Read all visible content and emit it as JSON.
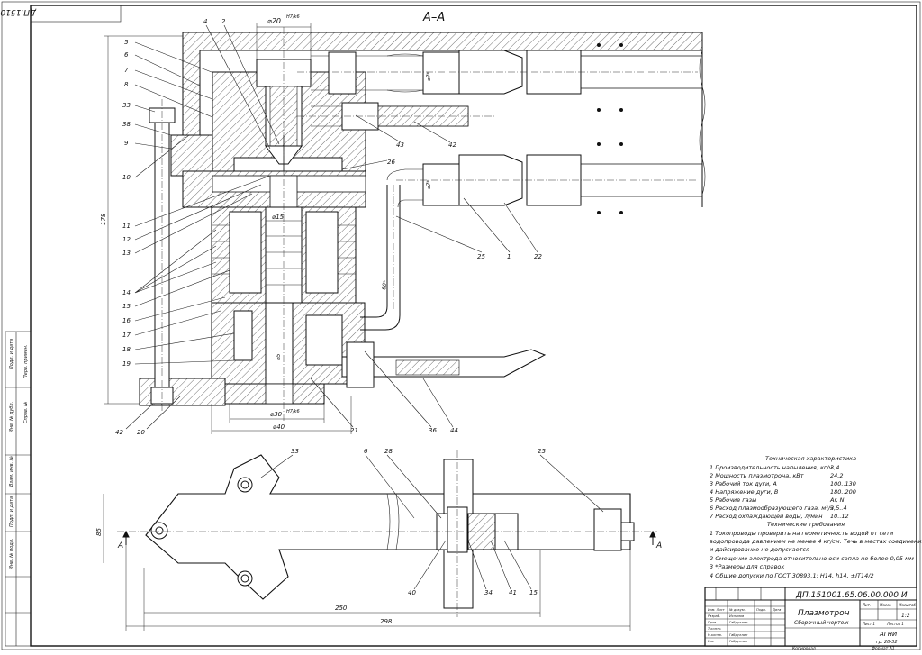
{
  "drawing": {
    "section_label": "А–А",
    "rotated_stamp": "ДП.151001.65.06.00.000 И",
    "side_cells": [
      "Подп. и дата",
      "Инв. № дубл.",
      "Взам. инв. №",
      "Подп. и дата",
      "Инв. № подл.",
      "Справ. №",
      "Перв. примен."
    ],
    "dims_top": {
      "d_top": "⌀20",
      "d_top_fit": "H7/k6",
      "d15": "⌀15",
      "d30": "⌀30",
      "d30_fit": "H7/k6",
      "d40": "⌀40",
      "d5": "⌀5",
      "d7a": "⌀7*",
      "d7b": "⌀7*",
      "r60": "60*",
      "h178": "178"
    },
    "dims_bottom": {
      "w250": "250",
      "w298": "298",
      "h85": "85",
      "section_mark": "A"
    },
    "leaders_left": [
      "5",
      "6",
      "7",
      "8",
      "33",
      "38",
      "9",
      "10",
      "11",
      "12",
      "13",
      "14",
      "15",
      "16",
      "17",
      "18",
      "19",
      "42",
      "20"
    ],
    "leaders_top": [
      "4",
      "2"
    ],
    "leaders_right": [
      "43",
      "42",
      "26",
      "25",
      "1",
      "22",
      "21",
      "36",
      "44"
    ],
    "leaders_plan": [
      "33",
      "6",
      "28",
      "25",
      "40",
      "34",
      "41",
      "15"
    ]
  },
  "specs": {
    "title": "Техническая характеристика",
    "rows": [
      {
        "label": "1 Производительность напыления, кг/ч",
        "value": "3,4"
      },
      {
        "label": "2 Мощность плазмотрона, кВт",
        "value": "24,2"
      },
      {
        "label": "3 Рабочий ток дуги, А",
        "value": "100..130"
      },
      {
        "label": "4 Напряжение дуги, В",
        "value": "180..200"
      },
      {
        "label": "5 Рабочие газы",
        "value": "Ar, N"
      },
      {
        "label": "6 Расход плазмообразующего газа, м³/ч",
        "value": "3,5..4"
      },
      {
        "label": "7 Расход охлаждающей воды, л/мин",
        "value": "10..12"
      }
    ],
    "req_title": "Технические требования",
    "requirements": [
      "1 Токопроводы проверить на герметичность водой от сети",
      "водопровода давлением не менее 4 кг/см. Течь в местах соединения",
      "и дайсирование не допускается",
      "2 Смещение электрода относительно оси сопла не более 0,05 мм",
      "3 *Размеры для справок",
      "4 Общие допуски по ГОСТ 30893.1: H14, h14, ±IT14/2"
    ]
  },
  "title_block": {
    "doc_number": "ДП.151001.65.06.00.000 И",
    "name": "Плазмотрон",
    "doc_type": "Сборочный чертеж",
    "col_lit": "Лит.",
    "col_mass": "Масса",
    "col_scale": "Масштаб",
    "scale": "1:2",
    "sheet": "Лист 1",
    "sheets": "Листов 1",
    "org": "АГНИ",
    "group": "гр. 28-32",
    "rows": [
      {
        "role": "Изм. Лист",
        "name": "№ докум."
      },
      {
        "role": "Разраб.",
        "name": "Исламов"
      },
      {
        "role": "Пров.",
        "name": "Габдуллин"
      },
      {
        "role": "Т.контр.",
        "name": ""
      },
      {
        "role": "Н.контр.",
        "name": "Габдуллин"
      },
      {
        "role": "Утв.",
        "name": "Габдуллин"
      }
    ],
    "col_sign": "Подп.",
    "col_date": "Дата",
    "copied": "Копировал",
    "format": "Формат A1"
  }
}
